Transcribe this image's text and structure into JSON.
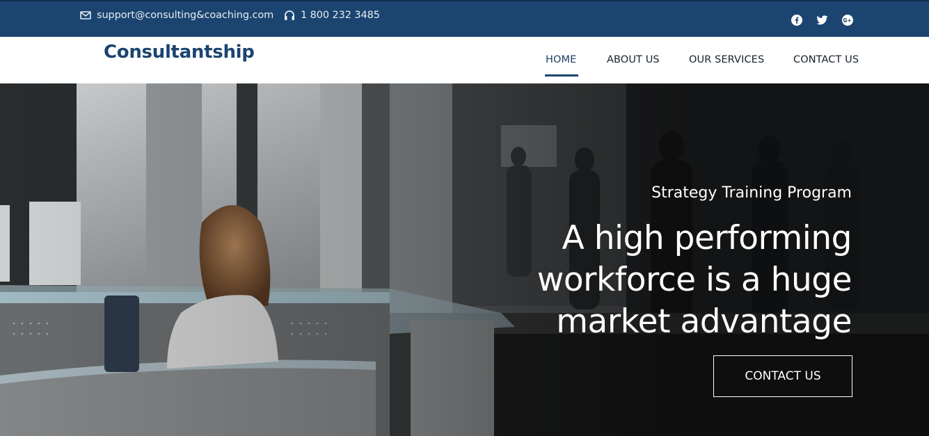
{
  "topbar": {
    "email": "support@consulting&coaching.com",
    "phone": "1 800 232 3485",
    "icons": {
      "email": "envelope-icon",
      "phone": "headset-icon",
      "social": [
        "facebook-icon",
        "twitter-icon",
        "google-plus-icon"
      ]
    },
    "background_color": "#1b4470"
  },
  "navbar": {
    "brand": "Consultantship",
    "links": [
      "HOME",
      "ABOUT US",
      "OUR SERVICES",
      "CONTACT US"
    ],
    "active": "HOME",
    "accent_color": "#1b4470"
  },
  "hero": {
    "subtitle": "Strategy Training Program",
    "headline_lines": [
      "A high performing",
      "workforce is a huge",
      "market advantage"
    ],
    "cta_label": "CONTACT US"
  }
}
